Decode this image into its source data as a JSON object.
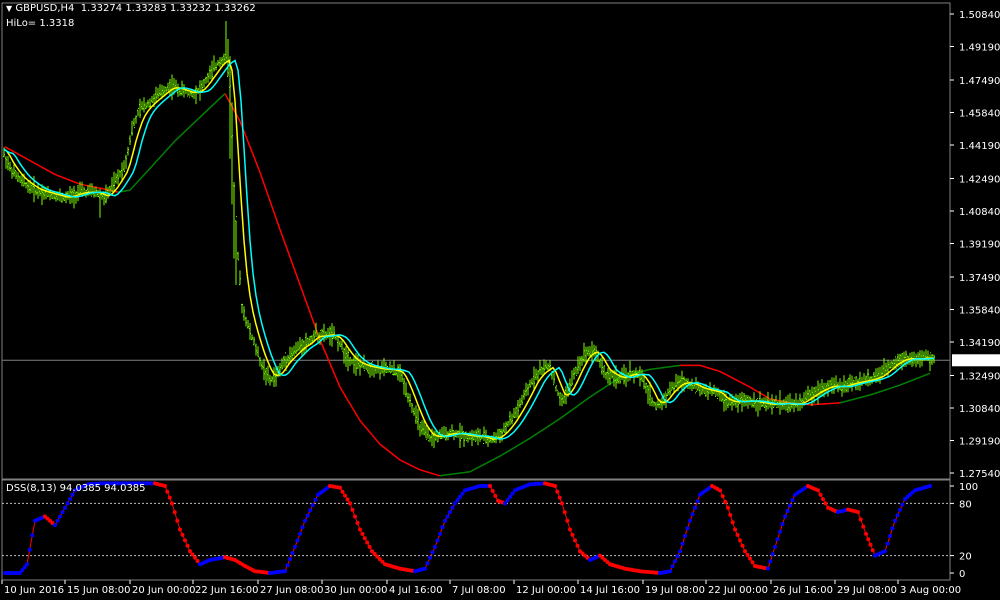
{
  "header": {
    "symbol_label": "GBPUSD,H4",
    "ohlc": "1.33274 1.33283 1.33232 1.33262",
    "hilo_label": "HiLo= 1.3318",
    "dss_label": "DSS(8,13) 94.0385 94.0385"
  },
  "colors": {
    "background": "#000000",
    "grid": "#808080",
    "price_bars": "#7CFC00",
    "fast_ma": "#FFFF00",
    "slow_ma": "#00FFFF",
    "hilo_red": "#FF0000",
    "hilo_green": "#008000",
    "dss_up": "#0000FF",
    "dss_down": "#FF0000"
  },
  "chart_data": [
    {
      "type": "line",
      "title": "GBPUSD,H4",
      "ylim": [
        1.2716,
        1.5146
      ],
      "y_ticks": [
        "1.50840",
        "1.49190",
        "1.47490",
        "1.45840",
        "1.44190",
        "1.42490",
        "1.40840",
        "1.39190",
        "1.37490",
        "1.35840",
        "1.34190",
        "1.32490",
        "1.30840",
        "1.29190",
        "1.27540"
      ],
      "current_price": "1.33262",
      "x_ticks": [
        "10 Jun 2016",
        "15 Jun 08:00",
        "20 Jun 00:00",
        "22 Jun 16:00",
        "27 Jun 08:00",
        "30 Jun 00:00",
        "4 Jul 16:00",
        "7 Jul 08:00",
        "12 Jul 00:00",
        "14 Jul 16:00",
        "19 Jul 08:00",
        "22 Jul 00:00",
        "26 Jul 16:00",
        "29 Jul 08:00",
        "3 Aug 00:00"
      ],
      "price_path": [
        [
          0,
          1.442
        ],
        [
          10,
          1.43
        ],
        [
          20,
          1.424
        ],
        [
          35,
          1.419
        ],
        [
          50,
          1.417
        ],
        [
          65,
          1.415
        ],
        [
          80,
          1.418
        ],
        [
          95,
          1.418
        ],
        [
          105,
          1.415
        ],
        [
          115,
          1.423
        ],
        [
          125,
          1.432
        ],
        [
          132,
          1.45
        ],
        [
          140,
          1.46
        ],
        [
          150,
          1.464
        ],
        [
          160,
          1.468
        ],
        [
          170,
          1.472
        ],
        [
          180,
          1.47
        ],
        [
          190,
          1.468
        ],
        [
          200,
          1.47
        ],
        [
          210,
          1.478
        ],
        [
          220,
          1.485
        ],
        [
          226,
          1.486
        ],
        [
          230,
          1.47
        ],
        [
          234,
          1.42
        ],
        [
          238,
          1.385
        ],
        [
          242,
          1.36
        ],
        [
          248,
          1.35
        ],
        [
          255,
          1.34
        ],
        [
          262,
          1.33
        ],
        [
          270,
          1.322
        ],
        [
          278,
          1.326
        ],
        [
          285,
          1.333
        ],
        [
          292,
          1.336
        ],
        [
          300,
          1.34
        ],
        [
          308,
          1.342
        ],
        [
          315,
          1.346
        ],
        [
          322,
          1.345
        ],
        [
          330,
          1.346
        ],
        [
          338,
          1.343
        ],
        [
          345,
          1.336
        ],
        [
          352,
          1.332
        ],
        [
          360,
          1.33
        ],
        [
          370,
          1.329
        ],
        [
          380,
          1.328
        ],
        [
          390,
          1.328
        ],
        [
          400,
          1.326
        ],
        [
          408,
          1.315
        ],
        [
          415,
          1.305
        ],
        [
          422,
          1.297
        ],
        [
          430,
          1.293
        ],
        [
          440,
          1.294
        ],
        [
          450,
          1.296
        ],
        [
          460,
          1.295
        ],
        [
          470,
          1.294
        ],
        [
          480,
          1.294
        ],
        [
          490,
          1.292
        ],
        [
          498,
          1.294
        ],
        [
          505,
          1.298
        ],
        [
          512,
          1.303
        ],
        [
          520,
          1.31
        ],
        [
          528,
          1.318
        ],
        [
          535,
          1.325
        ],
        [
          542,
          1.328
        ],
        [
          550,
          1.33
        ],
        [
          556,
          1.318
        ],
        [
          562,
          1.311
        ],
        [
          570,
          1.32
        ],
        [
          578,
          1.33
        ],
        [
          586,
          1.337
        ],
        [
          594,
          1.338
        ],
        [
          600,
          1.332
        ],
        [
          606,
          1.325
        ],
        [
          612,
          1.325
        ],
        [
          620,
          1.323
        ],
        [
          630,
          1.326
        ],
        [
          640,
          1.325
        ],
        [
          648,
          1.317
        ],
        [
          655,
          1.309
        ],
        [
          662,
          1.311
        ],
        [
          670,
          1.318
        ],
        [
          680,
          1.322
        ],
        [
          690,
          1.321
        ],
        [
          700,
          1.318
        ],
        [
          710,
          1.317
        ],
        [
          718,
          1.316
        ],
        [
          724,
          1.312
        ],
        [
          732,
          1.311
        ],
        [
          740,
          1.312
        ],
        [
          750,
          1.312
        ],
        [
          760,
          1.311
        ],
        [
          770,
          1.31
        ],
        [
          780,
          1.311
        ],
        [
          790,
          1.31
        ],
        [
          800,
          1.311
        ],
        [
          810,
          1.315
        ],
        [
          820,
          1.318
        ],
        [
          830,
          1.32
        ],
        [
          840,
          1.319
        ],
        [
          850,
          1.321
        ],
        [
          860,
          1.322
        ],
        [
          870,
          1.323
        ],
        [
          880,
          1.325
        ],
        [
          888,
          1.329
        ],
        [
          895,
          1.332
        ],
        [
          905,
          1.334
        ],
        [
          915,
          1.333
        ],
        [
          925,
          1.334
        ],
        [
          935,
          1.333
        ]
      ],
      "hilo_segments": [
        {
          "color": "red",
          "points": [
            [
              5,
              1.441
            ],
            [
              30,
              1.434
            ],
            [
              55,
              1.427
            ],
            [
              80,
              1.422
            ],
            [
              100,
              1.42
            ],
            [
              118,
              1.418
            ]
          ]
        },
        {
          "color": "green",
          "points": [
            [
              118,
              1.418
            ],
            [
              130,
              1.419
            ],
            [
              150,
              1.43
            ],
            [
              175,
              1.444
            ],
            [
              200,
              1.456
            ],
            [
              225,
              1.468
            ]
          ]
        },
        {
          "color": "red",
          "points": [
            [
              225,
              1.468
            ],
            [
              240,
              1.454
            ],
            [
              260,
              1.428
            ],
            [
              280,
              1.399
            ],
            [
              300,
              1.371
            ],
            [
              320,
              1.343
            ],
            [
              340,
              1.319
            ],
            [
              360,
              1.302
            ],
            [
              380,
              1.29
            ],
            [
              400,
              1.282
            ],
            [
              420,
              1.277
            ],
            [
              440,
              1.274
            ]
          ]
        },
        {
          "color": "green",
          "points": [
            [
              440,
              1.274
            ],
            [
              470,
              1.276
            ],
            [
              500,
              1.284
            ],
            [
              530,
              1.293
            ],
            [
              560,
              1.303
            ],
            [
              590,
              1.314
            ],
            [
              620,
              1.324
            ],
            [
              650,
              1.328
            ],
            [
              680,
              1.33
            ]
          ]
        },
        {
          "color": "red",
          "points": [
            [
              680,
              1.33
            ],
            [
              700,
              1.33
            ],
            [
              720,
              1.327
            ],
            [
              750,
              1.319
            ],
            [
              770,
              1.313
            ],
            [
              790,
              1.311
            ],
            [
              810,
              1.31
            ],
            [
              840,
              1.311
            ]
          ]
        },
        {
          "color": "green",
          "points": [
            [
              840,
              1.311
            ],
            [
              870,
              1.315
            ],
            [
              900,
              1.32
            ],
            [
              930,
              1.326
            ]
          ]
        }
      ]
    },
    {
      "type": "line",
      "title": "DSS(8,13)",
      "ylim": [
        -5,
        105
      ],
      "y_ticks": [
        100,
        80,
        20,
        0
      ],
      "levels": [
        80,
        20
      ],
      "series": [
        {
          "name": "DSS(8,13)",
          "values": [
            [
              5,
              0
            ],
            [
              20,
              0
            ],
            [
              27,
              10
            ],
            [
              35,
              60
            ],
            [
              45,
              65
            ],
            [
              55,
              55
            ],
            [
              65,
              75
            ],
            [
              75,
              95
            ],
            [
              88,
              102
            ],
            [
              100,
              103
            ],
            [
              120,
              103
            ],
            [
              140,
              103
            ],
            [
              155,
              103
            ],
            [
              165,
              100
            ],
            [
              172,
              80
            ],
            [
              180,
              50
            ],
            [
              190,
              25
            ],
            [
              200,
              10
            ],
            [
              210,
              15
            ],
            [
              225,
              18
            ],
            [
              235,
              15
            ],
            [
              245,
              8
            ],
            [
              255,
              2
            ],
            [
              270,
              0
            ],
            [
              285,
              2
            ],
            [
              295,
              30
            ],
            [
              305,
              60
            ],
            [
              318,
              90
            ],
            [
              330,
              100
            ],
            [
              340,
              98
            ],
            [
              350,
              80
            ],
            [
              360,
              50
            ],
            [
              372,
              25
            ],
            [
              385,
              10
            ],
            [
              400,
              5
            ],
            [
              415,
              2
            ],
            [
              425,
              5
            ],
            [
              435,
              30
            ],
            [
              445,
              60
            ],
            [
              455,
              80
            ],
            [
              465,
              95
            ],
            [
              480,
              100
            ],
            [
              490,
              100
            ],
            [
              498,
              83
            ],
            [
              505,
              80
            ],
            [
              515,
              95
            ],
            [
              530,
              102
            ],
            [
              545,
              103
            ],
            [
              555,
              100
            ],
            [
              562,
              80
            ],
            [
              570,
              50
            ],
            [
              580,
              25
            ],
            [
              590,
              15
            ],
            [
              600,
              20
            ],
            [
              610,
              10
            ],
            [
              625,
              5
            ],
            [
              640,
              2
            ],
            [
              660,
              0
            ],
            [
              670,
              2
            ],
            [
              680,
              25
            ],
            [
              690,
              60
            ],
            [
              700,
              90
            ],
            [
              712,
              100
            ],
            [
              720,
              95
            ],
            [
              728,
              75
            ],
            [
              735,
              50
            ],
            [
              745,
              25
            ],
            [
              755,
              8
            ],
            [
              768,
              5
            ],
            [
              775,
              30
            ],
            [
              785,
              65
            ],
            [
              795,
              90
            ],
            [
              808,
              100
            ],
            [
              818,
              95
            ],
            [
              828,
              75
            ],
            [
              838,
              70
            ],
            [
              848,
              73
            ],
            [
              858,
              70
            ],
            [
              866,
              45
            ],
            [
              875,
              20
            ],
            [
              885,
              25
            ],
            [
              895,
              60
            ],
            [
              905,
              85
            ],
            [
              915,
              95
            ],
            [
              930,
              100
            ]
          ]
        }
      ]
    }
  ]
}
